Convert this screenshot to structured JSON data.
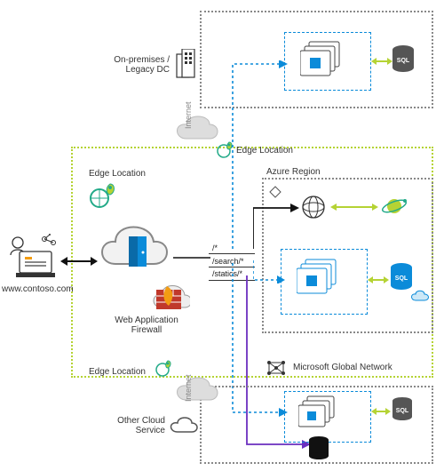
{
  "labels": {
    "onprem": "On-premises /\nLegacy DC",
    "edge_top": "Edge Location",
    "edge_left_top": "Edge Location",
    "edge_left_bottom": "Edge Location",
    "azure_region": "Azure Region",
    "waf": "Web Application\nFirewall",
    "user_url": "www.contoso.com",
    "ms_network": "Microsoft Global Network",
    "other_cloud": "Other Cloud\nService",
    "internet_top": "Internet",
    "internet_bottom": "Internet"
  },
  "routes": {
    "r1": "/*",
    "r2": "/search/*",
    "r3": "/statics/*"
  },
  "icons": {
    "user": "user-laptop-icon",
    "building": "building-icon",
    "cloud_door": "cloud-door-icon",
    "firewall": "firewall-icon",
    "edge_pin": "edge-pin-icon",
    "vmss_blue": "vm-scaleset-icon",
    "sql": "sql-database-icon",
    "cloud_small": "cloud-icon",
    "db_black": "database-icon",
    "globe": "globe-icon",
    "cosmos": "cosmos-icon",
    "network": "network-mesh-icon",
    "internet_cloud": "internet-cloud-icon"
  },
  "colors": {
    "blue": "#0b8bd9",
    "green": "#b5d334",
    "gray": "#7a7a7a",
    "purple": "#6b2fbf",
    "black": "#111"
  }
}
